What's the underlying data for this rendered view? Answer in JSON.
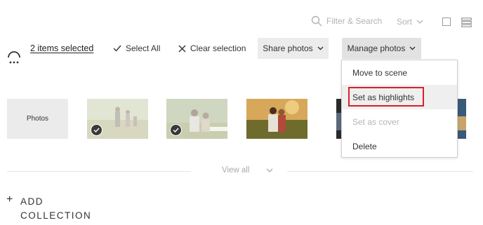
{
  "toolbar": {
    "filter_label": "Filter & Search",
    "sort_label": "Sort"
  },
  "selection_bar": {
    "items_selected": "2 items selected",
    "select_all": "Select All",
    "clear_selection": "Clear selection",
    "share_photos": "Share photos",
    "manage_photos": "Manage photos"
  },
  "thumbnails": {
    "photos_tile_label": "Photos",
    "selected_flags": [
      true,
      true,
      false,
      false
    ]
  },
  "view_all_label": "View all",
  "add_collection": {
    "line1": "ADD",
    "line2": "COLLECTION"
  },
  "dropdown": {
    "items": [
      {
        "label": "Move to scene",
        "state": "normal"
      },
      {
        "label": "Set as highlights",
        "state": "hover-highlighted"
      },
      {
        "label": "Set as cover",
        "state": "disabled"
      },
      {
        "label": "Delete",
        "state": "normal"
      }
    ]
  },
  "colors": {
    "highlight_border": "#d9202a",
    "button_bg": "#ececec",
    "check_badge": "#3a3a3a"
  }
}
